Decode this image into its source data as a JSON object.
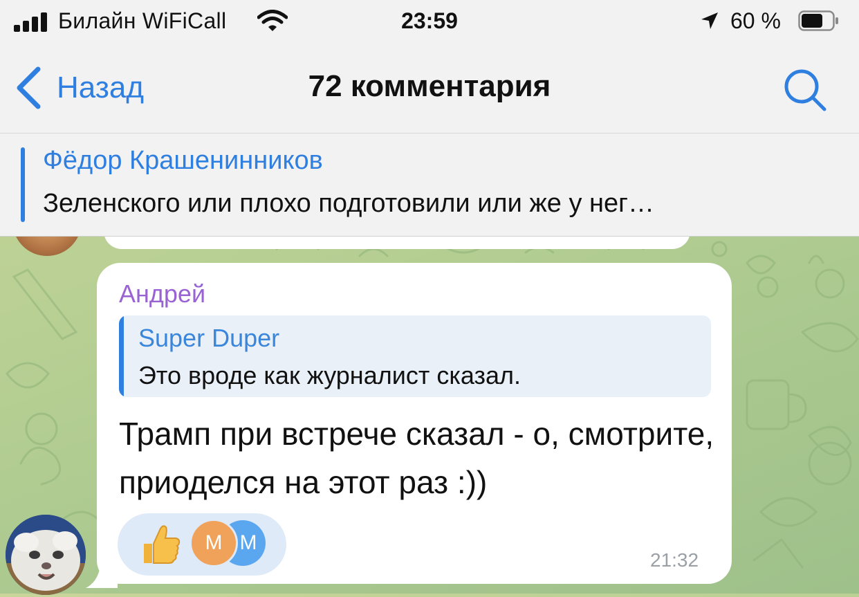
{
  "status_bar": {
    "carrier": "Билайн WiFiCall",
    "time": "23:59",
    "battery_percent": "60 %",
    "icons": [
      "signal-icon",
      "wifi-icon",
      "location-arrow-icon",
      "battery-icon"
    ]
  },
  "nav": {
    "back_label": "Назад",
    "title": "72 комментария",
    "back_icon": "chevron-left-icon",
    "search_icon": "search-icon",
    "accent_color": "#2f7fe0"
  },
  "pinned": {
    "name": "Фёдор Крашенинников",
    "text": "Зеленского или плохо подготовили или же у нег…"
  },
  "message": {
    "author": "Андрей",
    "author_color": "#9a63d4",
    "reply": {
      "name": "Super Duper",
      "text": "Это вроде как журналист сказал."
    },
    "text": "Трамп при встрече сказал - о, смотрите, приоделся на этот раз :))",
    "time": "21:32",
    "reactions": {
      "emoji": "thumbs-up-icon",
      "avatars": [
        "М",
        "М"
      ]
    }
  }
}
